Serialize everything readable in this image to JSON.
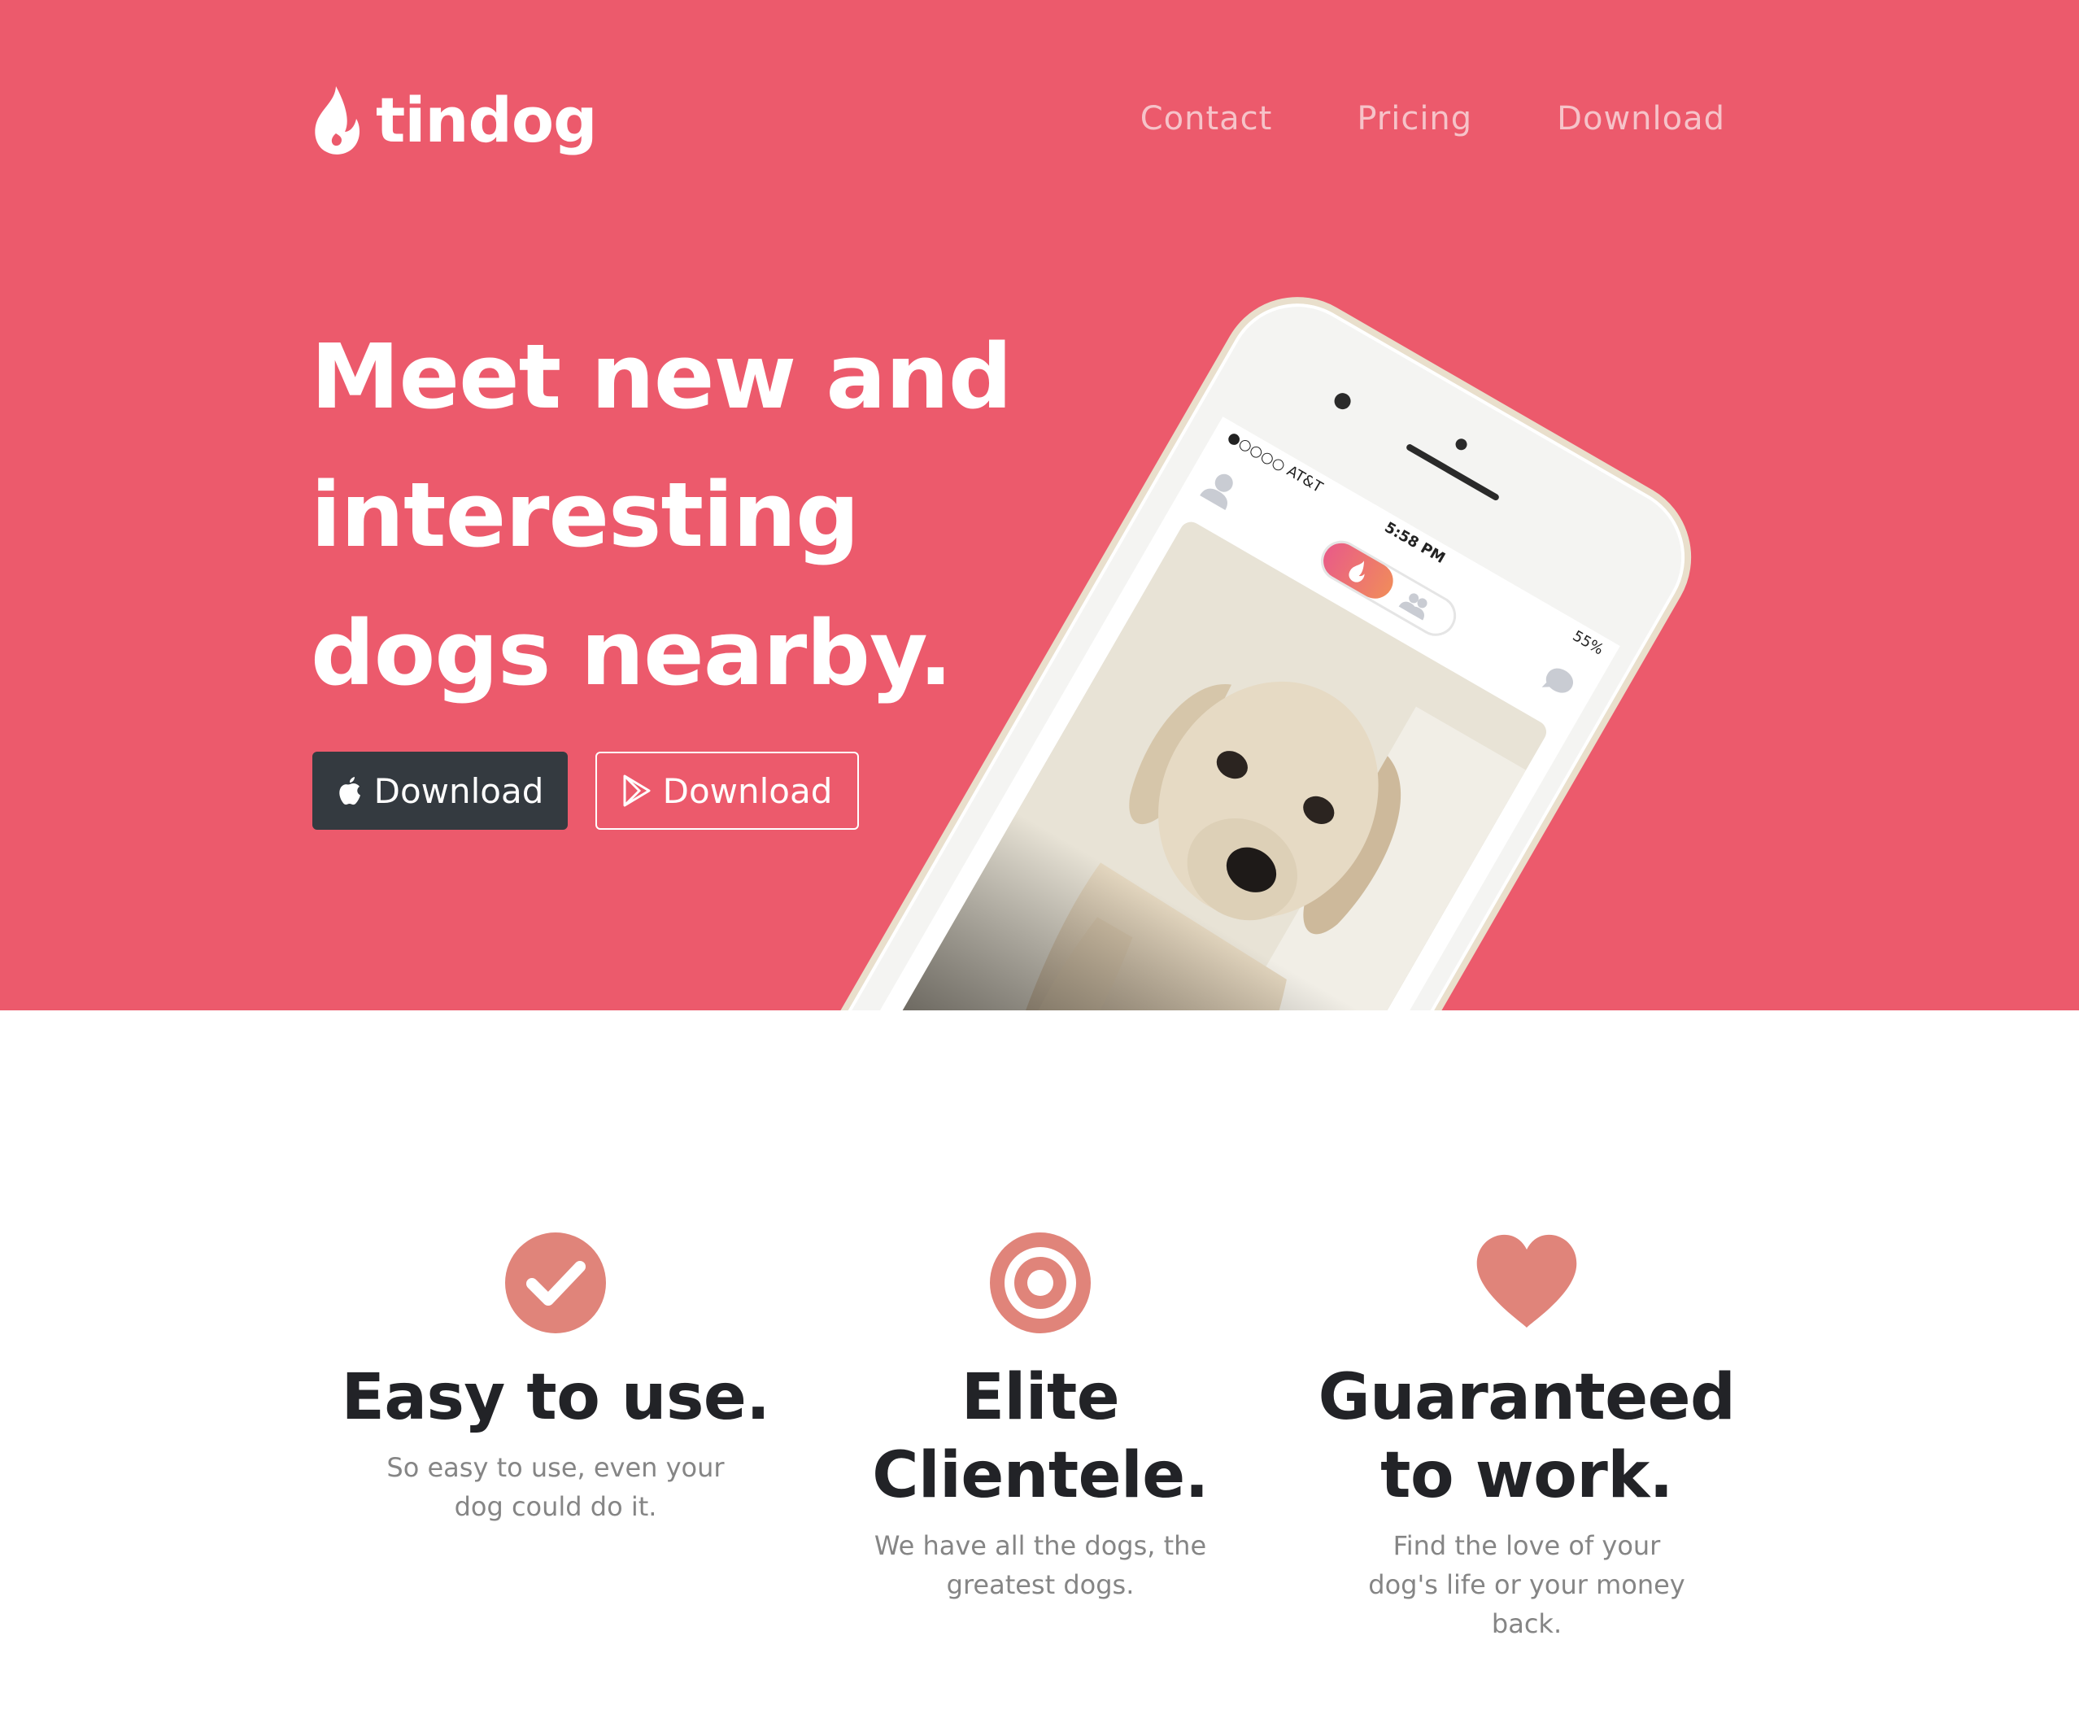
{
  "nav": {
    "brand": "tindog",
    "links": [
      "Contact",
      "Pricing",
      "Download"
    ]
  },
  "hero": {
    "headline": "Meet new and interesting dogs nearby.",
    "buttons": {
      "apple_label": "Download",
      "play_label": "Download"
    }
  },
  "phone": {
    "carrier": "●○○○○ AT&T",
    "time": "5:58 PM",
    "battery": "55%"
  },
  "features": [
    {
      "icon": "check-circle-icon",
      "title": "Easy to use.",
      "text": "So easy to use, even your dog could do it."
    },
    {
      "icon": "bullseye-icon",
      "title": "Elite Clientele.",
      "text": "We have all the dogs, the greatest dogs."
    },
    {
      "icon": "heart-icon",
      "title": "Guaranteed to work.",
      "text": "Find the love of your dog's life or your money back."
    }
  ],
  "colors": {
    "hero_bg": "#ec5a6c",
    "icon_accent": "#e0847a",
    "dark_button": "#343a40",
    "heading": "#222327"
  }
}
